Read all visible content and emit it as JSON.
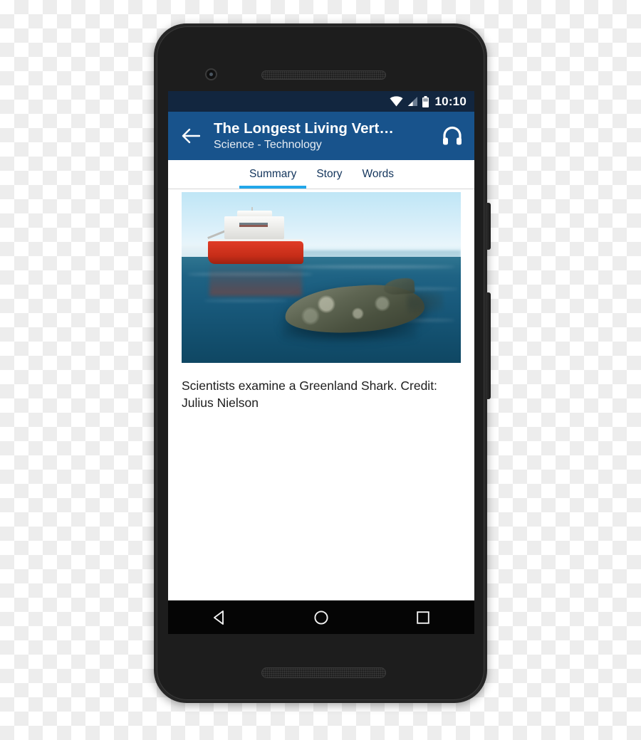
{
  "device": {
    "name": "android-smartphone",
    "front_camera": "front-camera",
    "earpiece": "earpiece-speaker",
    "bottom_speaker": "bottom-speaker",
    "power_button": "power-button",
    "volume_button": "volume-button"
  },
  "status_bar": {
    "time": "10:10",
    "wifi_icon": "wifi-icon",
    "signal_icon": "cell-signal-icon",
    "battery_icon": "battery-icon",
    "background": "#12263f"
  },
  "app_bar": {
    "back_icon": "back-arrow-icon",
    "title": "The Longest Living Vert…",
    "subtitle": "Science - Technology",
    "action_icon": "headphones-icon",
    "background": "#18538c"
  },
  "tabs": {
    "active_index": 0,
    "indicator_color": "#22a7ea",
    "items": [
      {
        "label": "Summary"
      },
      {
        "label": "Story"
      },
      {
        "label": "Words"
      }
    ]
  },
  "content": {
    "image_alt": "Scientists on a red research vessel observe a Greenland shark swimming at the ocean surface",
    "caption": "Scientists examine a Greenland Shark. Credit: Julius Nielson"
  },
  "nav_bar": {
    "back": "nav-back-icon",
    "home": "nav-home-icon",
    "recents": "nav-recents-icon",
    "background": "#050505"
  }
}
